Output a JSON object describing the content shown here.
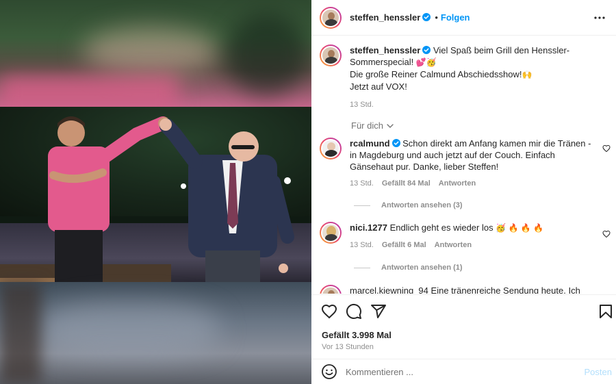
{
  "post": {
    "username": "steffen_henssler",
    "follow_label": "Folgen",
    "dot": "•"
  },
  "caption": {
    "username": "steffen_henssler",
    "line1": "Viel Spaß beim Grill den Henssler-Sommerspecial!",
    "line1_emoji": "💕🥳",
    "line2": "Die große Reiner Calmund Abschiedsshow!",
    "line2_emoji": "🙌",
    "line3": "Jetzt auf VOX!",
    "age": "13 Std."
  },
  "for_you_label": "Für dich",
  "comments": [
    {
      "username": "rcalmund",
      "text": "Schon direkt am Anfang kamen mir die Tränen - in Magdeburg und auch jetzt auf der Couch. Einfach Gänsehaut pur. Danke, lieber Steffen!",
      "age": "13 Std.",
      "likes": "Gefällt 84 Mal",
      "reply": "Antworten",
      "view_replies": "Antworten ansehen (3)"
    },
    {
      "username": "nici.1277",
      "text": "Endlich geht es wieder los",
      "emoji": "🥳 🔥 🔥 🔥",
      "age": "13 Std.",
      "likes": "Gefällt 6 Mal",
      "reply": "Antworten",
      "view_replies": "Antworten ansehen (1)"
    },
    {
      "username": "marcel.kiewning_94",
      "text": "Eine tränenreiche Sendung heute. Ich"
    }
  ],
  "stats": {
    "likes": "Gefällt 3.998 Mal",
    "time": "Vor 13 Stunden"
  },
  "composer": {
    "placeholder": "Kommentieren ...",
    "post_label": "Posten"
  },
  "icons": {
    "verified": "verified-badge-icon",
    "more": "more-options-icon",
    "like": "heart-icon",
    "comment": "comment-icon",
    "share": "share-icon",
    "save": "bookmark-icon",
    "emoji": "emoji-icon",
    "chevron": "chevron-down-icon"
  },
  "colors": {
    "accent": "#0095f6",
    "text": "#262626",
    "muted": "#8e8e8e"
  }
}
